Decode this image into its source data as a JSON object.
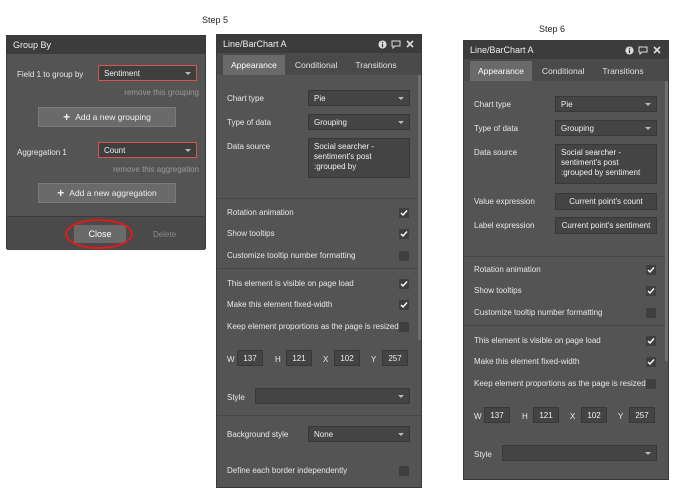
{
  "step5_label": "Step 5",
  "step6_label": "Step 6",
  "group_by": {
    "title": "Group By",
    "field1_label": "Field 1 to group by",
    "field1_value": "Sentiment",
    "remove_grouping": "remove this grouping",
    "add_grouping": "Add a new grouping",
    "agg_label": "Aggregation 1",
    "agg_value": "Count",
    "remove_aggregation": "remove this aggregation",
    "add_aggregation": "Add a new aggregation",
    "close": "Close",
    "delete": "Delete"
  },
  "panel_a": {
    "title": "Line/BarChart A",
    "tabs": [
      "Appearance",
      "Conditional",
      "Transitions"
    ],
    "chart_type_label": "Chart type",
    "chart_type": "Pie",
    "type_of_data_label": "Type of data",
    "type_of_data": "Grouping",
    "data_source_label": "Data source",
    "data_source_lines": [
      "Social searcher -",
      "sentiment's post",
      ":grouped by"
    ],
    "rotation": "Rotation animation",
    "tooltips": "Show tooltips",
    "tooltip_format": "Customize tooltip number formatting",
    "visible": "This element is visible on page load",
    "fixed_width": "Make this element fixed-width",
    "keep_prop": "Keep element proportions as the page is resized",
    "W": "W",
    "w_val": "137",
    "H": "H",
    "h_val": "121",
    "X": "X",
    "x_val": "102",
    "Y": "Y",
    "y_val": "257",
    "style_label": "Style",
    "style_value": "",
    "bg_label": "Background style",
    "bg_value": "None",
    "border_label": "Define each border independently"
  },
  "panel_b": {
    "title": "Line/BarChart A",
    "tabs": [
      "Appearance",
      "Conditional",
      "Transitions"
    ],
    "chart_type_label": "Chart type",
    "chart_type": "Pie",
    "type_of_data_label": "Type of data",
    "type_of_data": "Grouping",
    "data_source_label": "Data source",
    "data_source_lines": [
      "Social searcher -",
      "sentiment's post",
      ":grouped by sentiment"
    ],
    "value_expr_label": "Value expression",
    "value_expr": "Current point's count",
    "label_expr_label": "Label expression",
    "label_expr": "Current point's sentiment",
    "rotation": "Rotation animation",
    "tooltips": "Show tooltips",
    "tooltip_format": "Customize tooltip number formatting",
    "visible": "This element is visible on page load",
    "fixed_width": "Make this element fixed-width",
    "keep_prop": "Keep element proportions as the page is resized",
    "W": "W",
    "w_val": "137",
    "H": "H",
    "h_val": "121",
    "X": "X",
    "x_val": "102",
    "Y": "Y",
    "y_val": "257",
    "style_label": "Style",
    "style_value": ""
  },
  "icons": [
    "info-icon",
    "comment-icon",
    "close-icon",
    "check-icon",
    "plus-icon",
    "caret-down-icon"
  ]
}
